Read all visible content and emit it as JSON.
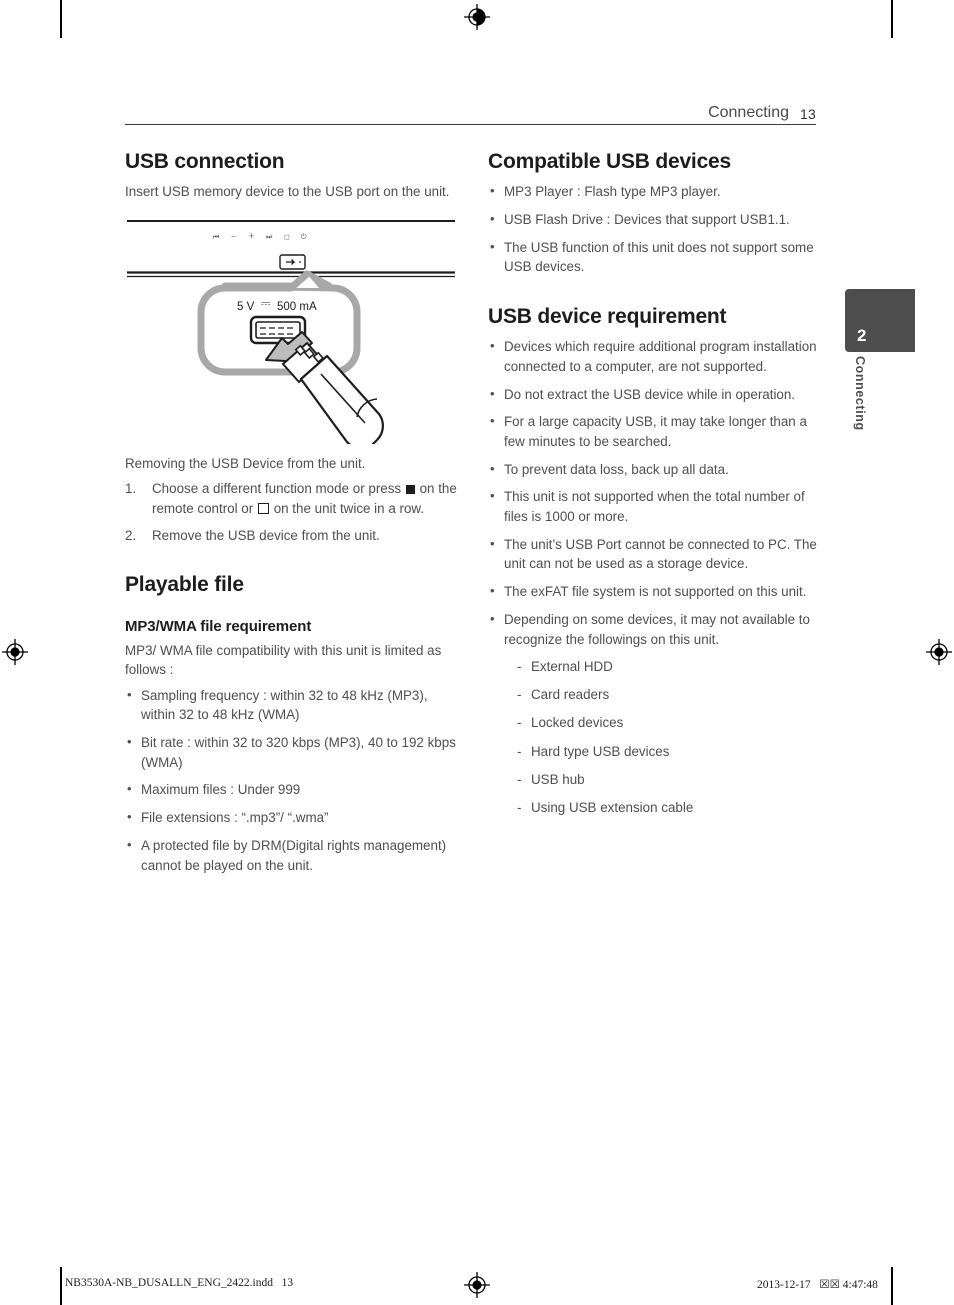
{
  "header": {
    "chapter_label": "Connecting",
    "page_number": "13"
  },
  "side_tab": {
    "number": "2",
    "label": "Connecting"
  },
  "left_column": {
    "usb_connection": {
      "heading": "USB connection",
      "intro": "Insert USB memory device to the USB port on the unit.",
      "figure": {
        "port_rating": "5 V",
        "port_rating_dc_symbol": "⎓",
        "port_current": "500 mA",
        "caption_alt": "USB memory stick being inserted into the USB port on the front of the unit"
      },
      "removing_intro": "Removing the USB Device from the unit.",
      "steps": [
        {
          "part1": "Choose a different function mode or press",
          "icon1": "stop-filled-square",
          "part2": "on the remote control or",
          "icon2": "stop-open-square",
          "part3": "on the unit twice in a row."
        },
        {
          "text": "Remove the USB device from the unit."
        }
      ]
    },
    "playable_file": {
      "heading": "Playable file",
      "subheading": "MP3/WMA file requirement",
      "intro": "MP3/ WMA file compatibility with this unit is limited as follows :",
      "bullets": [
        "Sampling frequency : within 32 to 48 kHz (MP3), within 32 to 48 kHz (WMA)",
        "Bit rate : within 32 to 320 kbps (MP3), 40 to 192 kbps (WMA)",
        "Maximum files : Under 999",
        "File extensions : “.mp3”/ “.wma”",
        "A protected file by DRM(Digital rights management) cannot be played on the unit."
      ]
    }
  },
  "right_column": {
    "compatible_usb_devices": {
      "heading": "Compatible USB devices",
      "bullets": [
        "MP3 Player : Flash type MP3 player.",
        "USB Flash Drive : Devices that support USB1.1.",
        "The USB function of this unit does not support some USB devices."
      ]
    },
    "usb_device_requirement": {
      "heading": "USB device requirement",
      "bullets": [
        "Devices which require additional program installation connected to a computer, are not supported.",
        "Do not extract the USB device while in operation.",
        "For a large capacity USB, it may take longer than a few minutes to be searched.",
        "To prevent data loss, back up all data.",
        "This unit is not supported when the total number of files is 1000 or more.",
        "The unit’s USB Port cannot be connected to PC. The unit can not be used as a storage device.",
        "The exFAT file system is not supported on this unit.",
        "Depending on some devices, it may not available to recognize the followings on this unit."
      ],
      "sub_items": [
        "External HDD",
        "Card readers",
        "Locked devices",
        "Hard type USB devices",
        "USB hub",
        "Using USB extension cable"
      ]
    }
  },
  "footer": {
    "file_name": "NB3530A-NB_DUSALLN_ENG_2422.indd   13",
    "timestamp": "2013-12-17   ☒☒ 4:47:48"
  },
  "colors": {
    "text": "#4f4f4f",
    "heading": "#1d1d1d",
    "tab_bg": "#4d4d4d",
    "rule": "#3a3a3a"
  }
}
